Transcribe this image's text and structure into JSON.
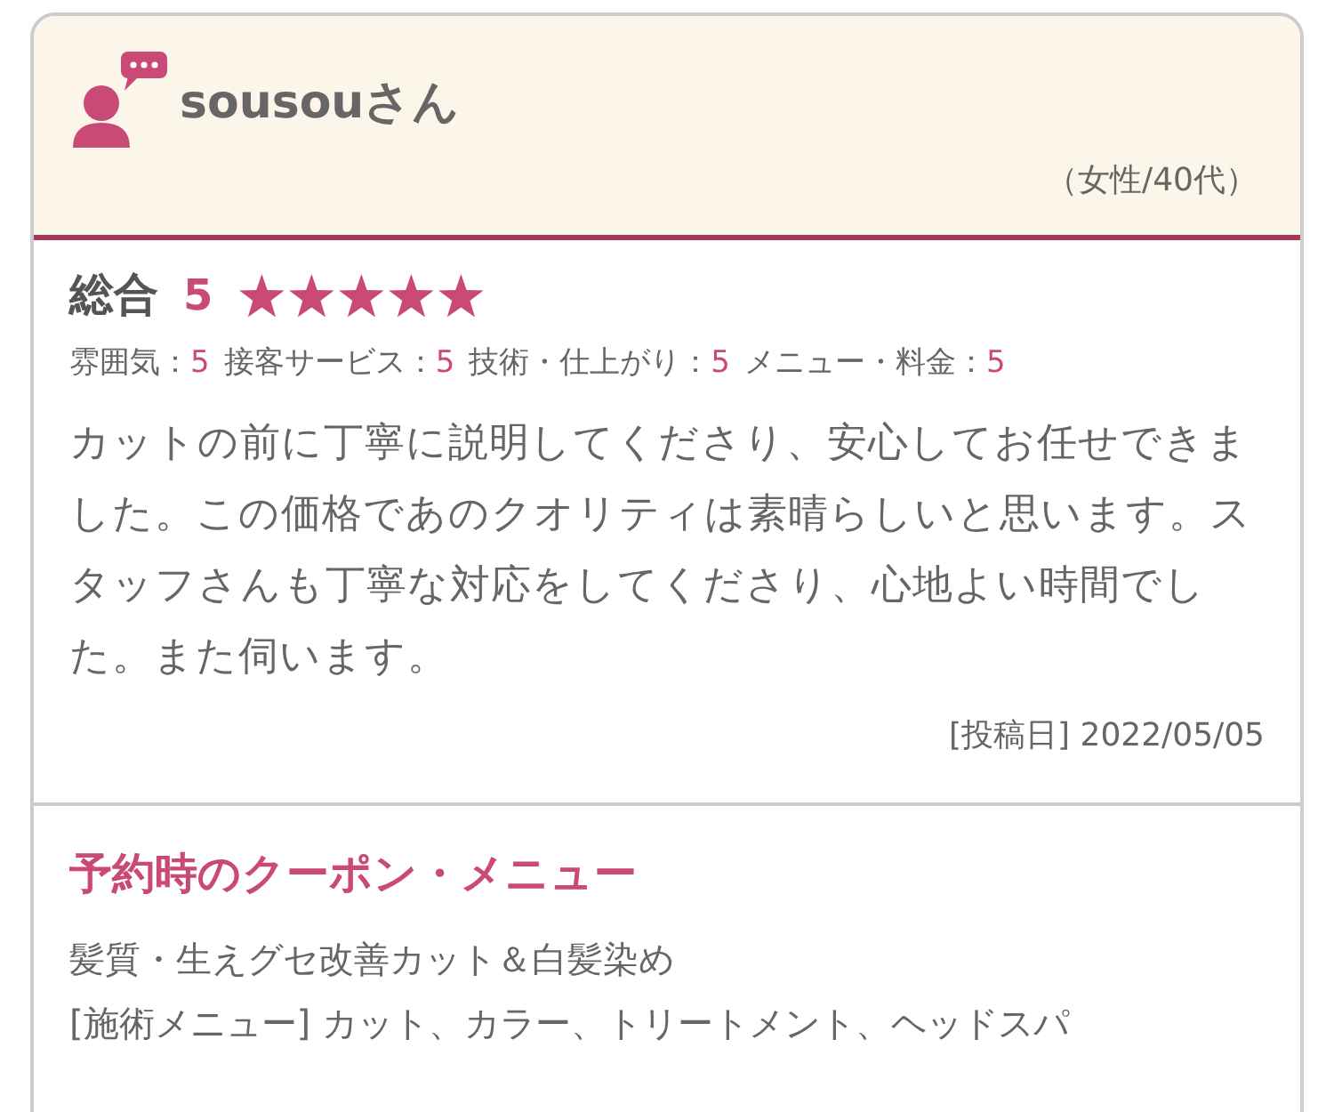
{
  "reviewer": {
    "name": "sousouさん",
    "profile": "（女性/40代）"
  },
  "rating": {
    "label": "総合",
    "score": "5",
    "stars": 5,
    "items": [
      {
        "label": "雰囲気：",
        "value": "5"
      },
      {
        "label": "接客サービス：",
        "value": "5"
      },
      {
        "label": "技術・仕上がり：",
        "value": "5"
      },
      {
        "label": "メニュー・料金：",
        "value": "5"
      }
    ]
  },
  "review_text": "カットの前に丁寧に説明してくださり、安心してお任せできました。この価格であのクオリティは素晴らしいと思います。スタッフさんも丁寧な対応をしてくださり、心地よい時間でした。また伺います。",
  "posted": "[投稿日] 2022/05/05",
  "coupon": {
    "title": "予約時のクーポン・メニュー",
    "name": "髪質・生えグセ改善カット＆白髪染め",
    "menu": "[施術メニュー] カット、カラー、トリートメント、ヘッドスパ"
  }
}
